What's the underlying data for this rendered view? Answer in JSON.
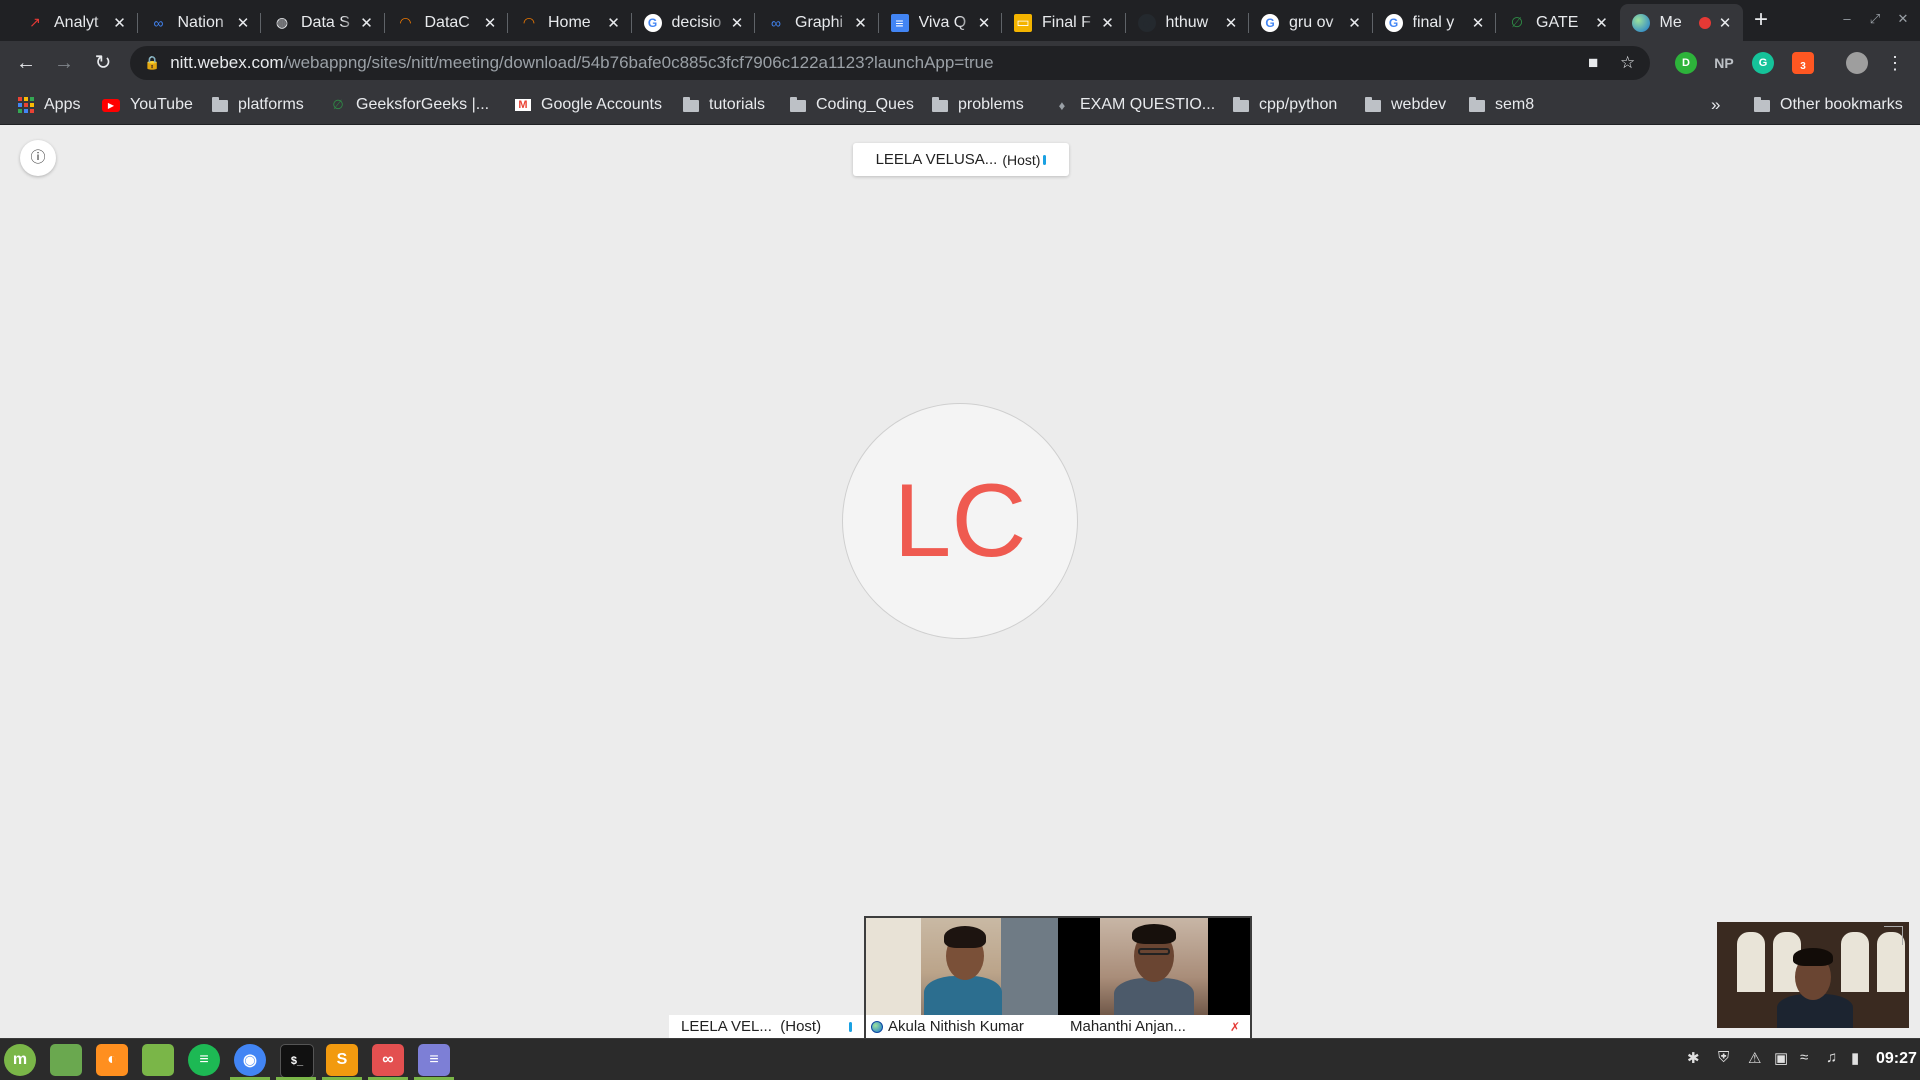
{
  "tabs": [
    {
      "title": "Analyt",
      "favicon": "analytics-icon",
      "color": "#e53935"
    },
    {
      "title": "Nation",
      "favicon": "meta-infinity-icon",
      "color": "#4285f4"
    },
    {
      "title": "Data S",
      "favicon": "globe-icon",
      "color": "#e8eaed"
    },
    {
      "title": "DataC",
      "favicon": "arc-icon",
      "color": "#f57c00"
    },
    {
      "title": "Home",
      "favicon": "arc-icon",
      "color": "#f57c00"
    },
    {
      "title": "decisio",
      "favicon": "google-icon",
      "color": "#ffffff"
    },
    {
      "title": "Graphi",
      "favicon": "meta-infinity-icon",
      "color": "#4285f4"
    },
    {
      "title": "Viva Q",
      "favicon": "docs-icon",
      "color": "#4285f4"
    },
    {
      "title": "Final F",
      "favicon": "slides-icon",
      "color": "#f4b400"
    },
    {
      "title": "hthuw",
      "favicon": "github-icon",
      "color": "#202124"
    },
    {
      "title": "gru ov",
      "favicon": "google-icon",
      "color": "#ffffff"
    },
    {
      "title": "final y",
      "favicon": "google-icon",
      "color": "#ffffff"
    },
    {
      "title": "GATE",
      "favicon": "gfg-icon",
      "color": "#2f8d46"
    },
    {
      "title": "Me",
      "favicon": "webex-icon",
      "color": "#34a853",
      "active": true
    }
  ],
  "address": {
    "host": "nitt.webex.com",
    "path": "/webappng/sites/nitt/meeting/download/54b76bafe0c885c3fcf7906c122a1123?launchApp=true"
  },
  "extensions": [
    {
      "label": "D",
      "color": "#2db33a"
    },
    {
      "label": "NP",
      "color": "transparent"
    },
    {
      "label": "G",
      "color": "#15c39a"
    },
    {
      "label": "3",
      "color": "#ff5722"
    }
  ],
  "bookmarks": [
    {
      "label": "Apps",
      "icon": "apps-grid-icon"
    },
    {
      "label": "YouTube",
      "icon": "youtube-icon"
    },
    {
      "label": "platforms",
      "icon": "folder-icon"
    },
    {
      "label": "GeeksforGeeks |...",
      "icon": "gfg-icon"
    },
    {
      "label": "Google Accounts",
      "icon": "gmail-icon"
    },
    {
      "label": "tutorials",
      "icon": "folder-icon"
    },
    {
      "label": "Coding_Ques",
      "icon": "folder-icon"
    },
    {
      "label": "problems",
      "icon": "folder-icon"
    },
    {
      "label": "EXAM QUESTIO...",
      "icon": "flame-icon"
    },
    {
      "label": "cpp/python",
      "icon": "folder-icon"
    },
    {
      "label": "webdev",
      "icon": "folder-icon"
    },
    {
      "label": "sem8",
      "icon": "folder-icon"
    }
  ],
  "more_bookmarks": "»",
  "other_bookmarks": "Other bookmarks",
  "meeting": {
    "active_speaker": "LEELA VELUSA...",
    "host_tag": "(Host)",
    "avatar_initials": "LC",
    "participants": [
      {
        "name": "LEELA VEL...",
        "tag": "(Host)",
        "state": "speaking"
      },
      {
        "name": "Akula Nithish Kumar",
        "tag": "",
        "state": "video"
      },
      {
        "name": "Mahanthi Anjan...",
        "tag": "",
        "state": "muted"
      }
    ]
  },
  "taskbar": {
    "apps": [
      {
        "icon": "mint-menu-icon",
        "color": "#7ab648"
      },
      {
        "icon": "show-desktop-icon",
        "color": "#6aa84f"
      },
      {
        "icon": "firefox-icon",
        "color": "#ff8f1f"
      },
      {
        "icon": "files-icon",
        "color": "#7ab648"
      },
      {
        "icon": "spotify-icon",
        "color": "#1db954"
      },
      {
        "icon": "chrome-icon",
        "color": "#4285f4"
      },
      {
        "icon": "terminal-icon",
        "color": "#111111"
      },
      {
        "icon": "sublime-icon",
        "color": "#f29a0f"
      },
      {
        "icon": "notes-icon",
        "color": "#e35050"
      },
      {
        "icon": "text-editor-icon",
        "color": "#7d7fd6"
      }
    ],
    "tray": [
      "bluetooth-icon",
      "shield-icon",
      "warning-icon",
      "screen-icon",
      "wifi-icon",
      "music-icon",
      "battery-icon"
    ],
    "clock": "09:27"
  }
}
